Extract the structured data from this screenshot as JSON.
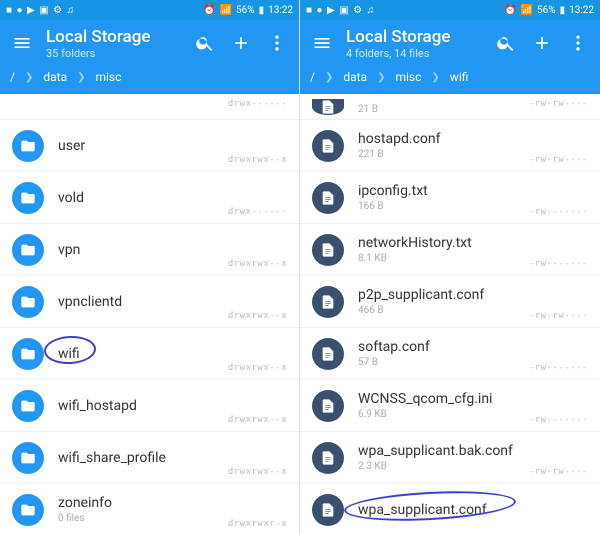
{
  "status": {
    "left_icons": "■ ● ▶ ▣ ⚙ ♫",
    "alarm_icon": "⏰",
    "signal_icon": "📶",
    "battery": "56%",
    "batt_icon": "▮",
    "time": "13:22"
  },
  "left": {
    "title": "Local Storage",
    "subtitle": "35 folders",
    "breadcrumb": {
      "root": "/",
      "items": [
        "data",
        "misc"
      ]
    },
    "rows": [
      {
        "name": "",
        "sub": "",
        "perm": "drwx------",
        "type": "folder",
        "cut": true
      },
      {
        "name": "user",
        "sub": "",
        "perm": "drwxrwx--x",
        "type": "folder"
      },
      {
        "name": "vold",
        "sub": "",
        "perm": "drwx------",
        "type": "folder"
      },
      {
        "name": "vpn",
        "sub": "",
        "perm": "drwxrwx--x",
        "type": "folder"
      },
      {
        "name": "vpnclientd",
        "sub": "",
        "perm": "drwxrwx--x",
        "type": "folder"
      },
      {
        "name": "wifi",
        "sub": "",
        "perm": "drwxrwx--x",
        "type": "folder",
        "circled": true
      },
      {
        "name": "wifi_hostapd",
        "sub": "",
        "perm": "drwxrwx--x",
        "type": "folder"
      },
      {
        "name": "wifi_share_profile",
        "sub": "",
        "perm": "drwxrwx--x",
        "type": "folder"
      },
      {
        "name": "zoneinfo",
        "sub": "0 files",
        "perm": "drwxrwxr-x",
        "type": "folder"
      }
    ]
  },
  "right": {
    "title": "Local Storage",
    "subtitle": "4 folders, 14 files",
    "breadcrumb": {
      "root": "/",
      "items": [
        "data",
        "misc",
        "wifi"
      ]
    },
    "rows": [
      {
        "name": "",
        "sub": "21 B",
        "perm": "-rw-rw----",
        "type": "file",
        "cut": true
      },
      {
        "name": "hostapd.conf",
        "sub": "221 B",
        "perm": "-rw-rw----",
        "type": "file"
      },
      {
        "name": "ipconfig.txt",
        "sub": "166 B",
        "perm": "-rw-------",
        "type": "file"
      },
      {
        "name": "networkHistory.txt",
        "sub": "8.1 KB",
        "perm": "-rw-------",
        "type": "file"
      },
      {
        "name": "p2p_supplicant.conf",
        "sub": "466 B",
        "perm": "-rw-rw----",
        "type": "file"
      },
      {
        "name": "softap.conf",
        "sub": "57 B",
        "perm": "-rw-------",
        "type": "file"
      },
      {
        "name": "WCNSS_qcom_cfg.ini",
        "sub": "6.9 KB",
        "perm": "-rw-------",
        "type": "file"
      },
      {
        "name": "wpa_supplicant.bak.conf",
        "sub": "2.3 KB",
        "perm": "-rw-rw----",
        "type": "file"
      },
      {
        "name": "wpa_supplicant.conf",
        "sub": "",
        "perm": "",
        "type": "file",
        "circled": true
      }
    ]
  }
}
